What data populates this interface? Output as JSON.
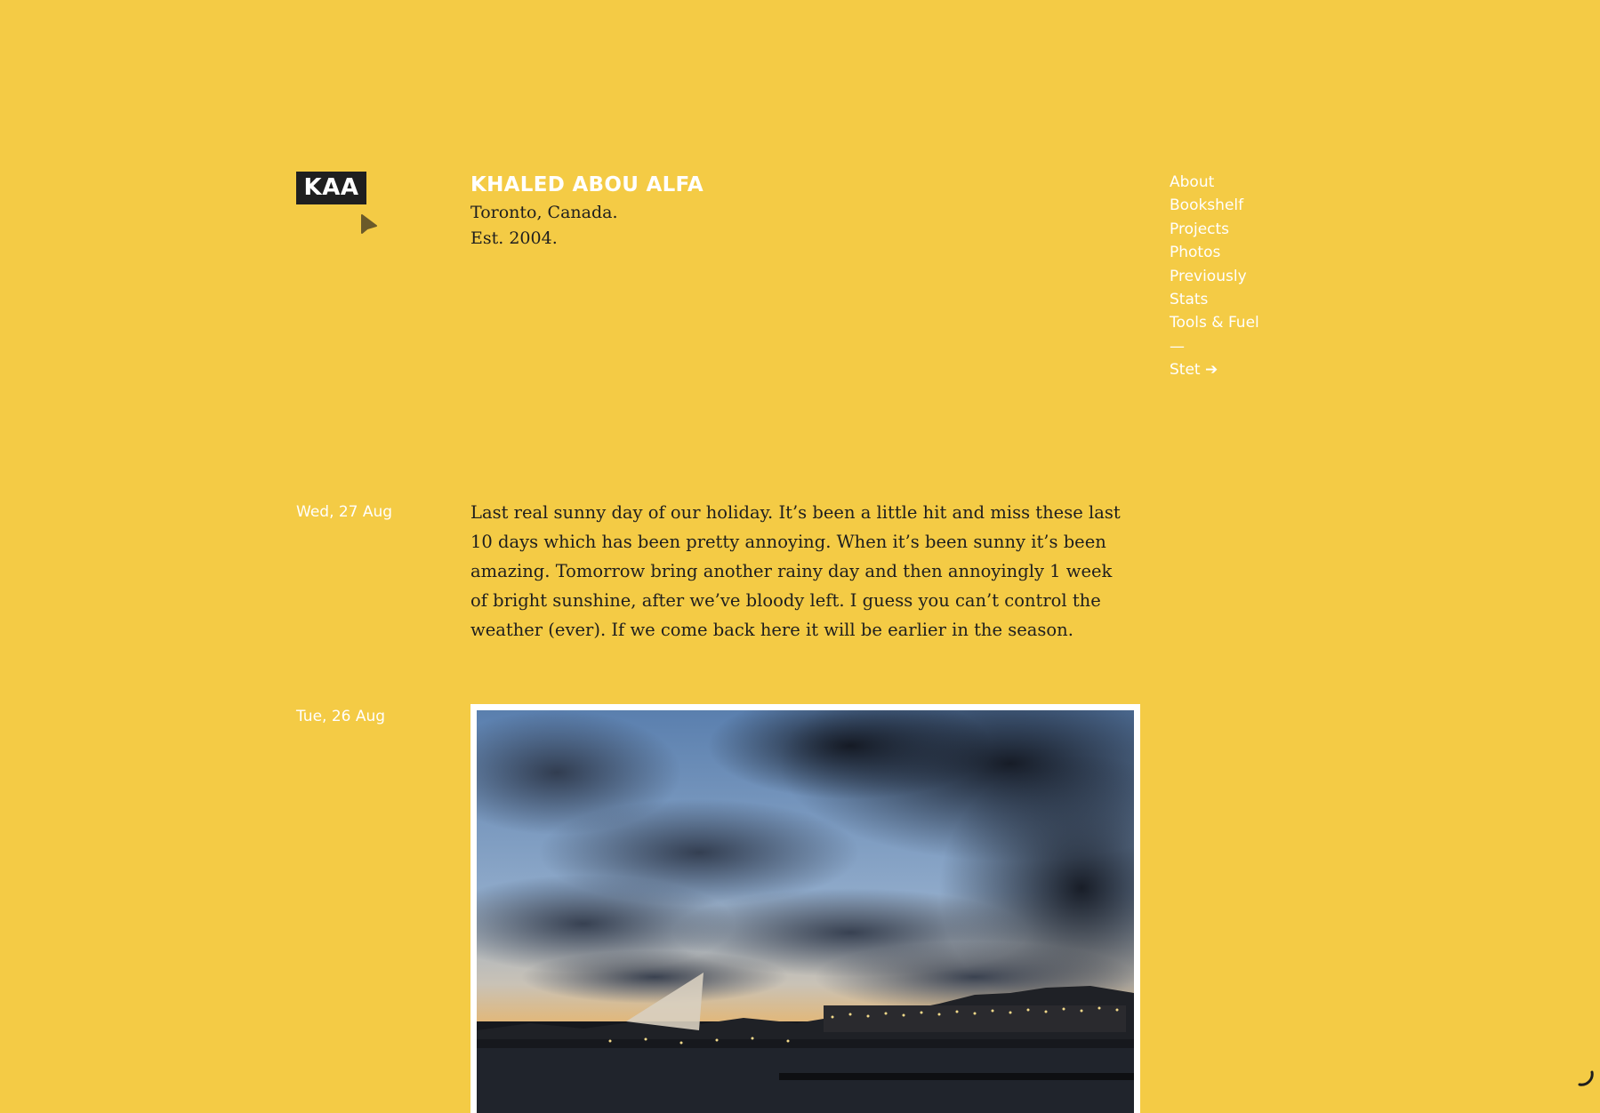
{
  "header": {
    "logo_text": "KAA",
    "site_name": "KHALED ABOU ALFA",
    "location": "Toronto, Canada.",
    "established": "Est. 2004."
  },
  "nav": {
    "items": [
      {
        "label": "About"
      },
      {
        "label": "Bookshelf"
      },
      {
        "label": "Projects"
      },
      {
        "label": "Photos"
      },
      {
        "label": "Previously"
      },
      {
        "label": "Stats"
      },
      {
        "label": "Tools & Fuel"
      }
    ],
    "separator": "—",
    "external_link": "Stet ➔"
  },
  "posts": [
    {
      "date": "Wed, 27 Aug",
      "text": "Last real sunny day of our holiday. It’s been a little hit and miss these last 10 days which has been pretty annoying. When it’s been sunny it’s been amazing. Tomorrow bring another rainy day and then annoyingly 1 week of bright sunshine, after we’ve bloody left. I guess you can’t control the weather (ever). If we come back here it will be earlier in the season."
    },
    {
      "date": "Tue, 26 Aug"
    }
  ],
  "colors": {
    "background": "#f4cb45",
    "logo_bg": "#1f1f1f",
    "nav_text": "#ffffff",
    "body_text": "#1e1e1e"
  },
  "icons": {
    "cursor": "arrow-cursor-icon",
    "loading": "loading-spinner-icon"
  }
}
